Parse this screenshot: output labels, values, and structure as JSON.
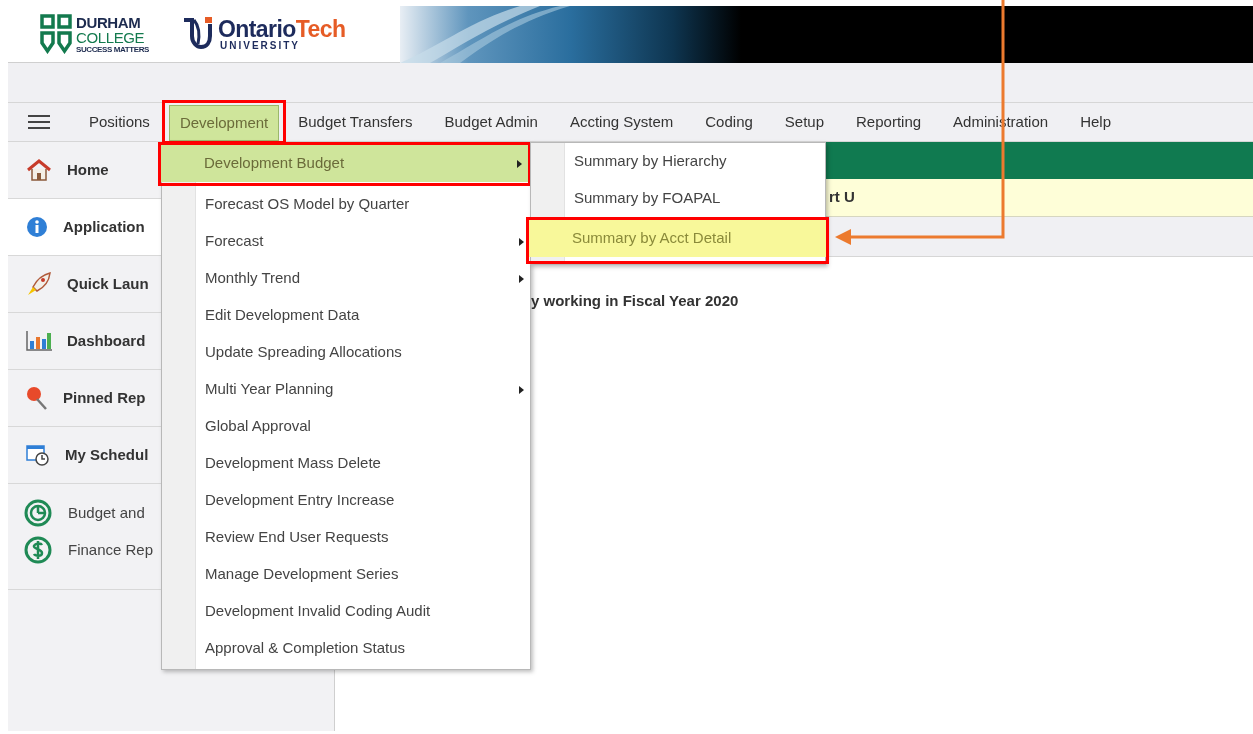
{
  "header": {
    "logo_1": {
      "line_1": "DURHAM",
      "line_2": "COLLEGE",
      "tagline": "SUCCESS MATTERS"
    },
    "logo_2": {
      "name_1": "Ontario",
      "name_2": "Tech",
      "subtitle": "UNIVERSITY"
    }
  },
  "menu_bar": [
    {
      "label": "Positions",
      "selected": false
    },
    {
      "label": "Development",
      "selected": true
    },
    {
      "label": "Budget Transfers",
      "selected": false
    },
    {
      "label": "Budget Admin",
      "selected": false
    },
    {
      "label": "Accting System",
      "selected": false
    },
    {
      "label": "Coding",
      "selected": false
    },
    {
      "label": "Setup",
      "selected": false
    },
    {
      "label": "Reporting",
      "selected": false
    },
    {
      "label": "Administration",
      "selected": false
    },
    {
      "label": "Help",
      "selected": false
    }
  ],
  "sidebar": {
    "items": [
      {
        "label": "Home",
        "kind": "nav",
        "selected": false
      },
      {
        "label": "Application",
        "kind": "nav",
        "selected": true
      },
      {
        "label": "Quick Laun",
        "kind": "nav",
        "selected": false
      },
      {
        "label": "Dashboard",
        "kind": "nav",
        "selected": false
      },
      {
        "label": "Pinned Rep",
        "kind": "nav",
        "selected": false
      },
      {
        "label": "My Schedul",
        "kind": "nav",
        "selected": false
      },
      {
        "label": "Budget and",
        "kind": "link",
        "selected": false
      },
      {
        "label": "Finance Rep",
        "kind": "link",
        "selected": false
      }
    ]
  },
  "main": {
    "notice": "rt U",
    "message": "y working in Fiscal Year 2020"
  },
  "dropdown": [
    {
      "label": "Development Budget",
      "has_submenu": true,
      "selected": true
    },
    {
      "label": "Forecast OS Model by Quarter",
      "has_submenu": false,
      "selected": false
    },
    {
      "label": "Forecast",
      "has_submenu": true,
      "selected": false
    },
    {
      "label": "Monthly Trend",
      "has_submenu": true,
      "selected": false
    },
    {
      "label": "Edit Development Data",
      "has_submenu": false,
      "selected": false
    },
    {
      "label": "Update Spreading Allocations",
      "has_submenu": false,
      "selected": false
    },
    {
      "label": "Multi Year Planning",
      "has_submenu": true,
      "selected": false
    },
    {
      "label": "Global Approval",
      "has_submenu": false,
      "selected": false
    },
    {
      "label": "Development Mass Delete",
      "has_submenu": false,
      "selected": false
    },
    {
      "label": "Development Entry Increase",
      "has_submenu": false,
      "selected": false
    },
    {
      "label": "Review End User Requests",
      "has_submenu": false,
      "selected": false
    },
    {
      "label": "Manage Development Series",
      "has_submenu": false,
      "selected": false
    },
    {
      "label": "Development Invalid Coding Audit",
      "has_submenu": false,
      "selected": false
    },
    {
      "label": "Approval & Completion Status",
      "has_submenu": false,
      "selected": false
    }
  ],
  "submenu": [
    {
      "label": "Summary by Hierarchy",
      "selected": false
    },
    {
      "label": "Summary by FOAPAL",
      "selected": false
    },
    {
      "label": "Summary by Acct Detail",
      "selected": true
    }
  ]
}
